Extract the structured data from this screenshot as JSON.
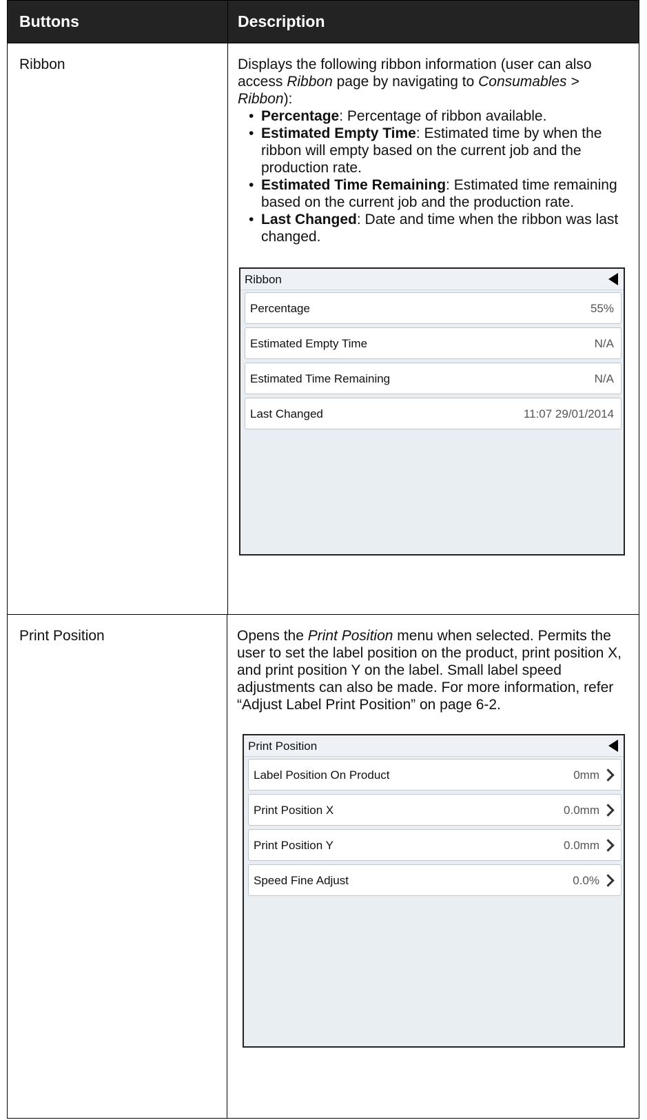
{
  "header": {
    "col1": "Buttons",
    "col2": "Description"
  },
  "ribbon": {
    "name": "Ribbon",
    "intro_a": "Displays the following ribbon information (user can also access ",
    "intro_italic1": "Ribbon",
    "intro_b": " page by navigating to ",
    "intro_italic2": "Consumables > Ribbon",
    "intro_c": "):",
    "bullets": [
      {
        "term": "Percentage",
        "text": ": Percentage of ribbon available."
      },
      {
        "term": "Estimated Empty Time",
        "text": ": Estimated time by when the ribbon will empty based on the current job and the production rate."
      },
      {
        "term": "Estimated Time Remaining",
        "text": ": Estimated time remaining based on the current job and the production rate."
      },
      {
        "term": "Last Changed",
        "text": ": Date and time when the ribbon was last changed."
      }
    ],
    "panel": {
      "title": "Ribbon",
      "items": [
        {
          "label": "Percentage",
          "value": "55%"
        },
        {
          "label": "Estimated Empty Time",
          "value": "N/A"
        },
        {
          "label": "Estimated Time Remaining",
          "value": "N/A"
        },
        {
          "label": "Last Changed",
          "value": "11:07 29/01/2014"
        }
      ]
    }
  },
  "print_position": {
    "name": "Print Position",
    "desc_a": "Opens the ",
    "desc_italic": "Print Position",
    "desc_b": " menu when selected. Permits the user to set the label position on the product, print position X, and print position Y on the label. Small label speed adjustments can also be made. For more information, refer “Adjust Label Print Position” on page 6-2.",
    "panel": {
      "title": "Print Position",
      "items": [
        {
          "label": "Label Position On Product",
          "value": "0mm"
        },
        {
          "label": "Print Position X",
          "value": "0.0mm"
        },
        {
          "label": "Print Position Y",
          "value": "0.0mm"
        },
        {
          "label": "Speed Fine Adjust",
          "value": "0.0%"
        }
      ]
    }
  }
}
